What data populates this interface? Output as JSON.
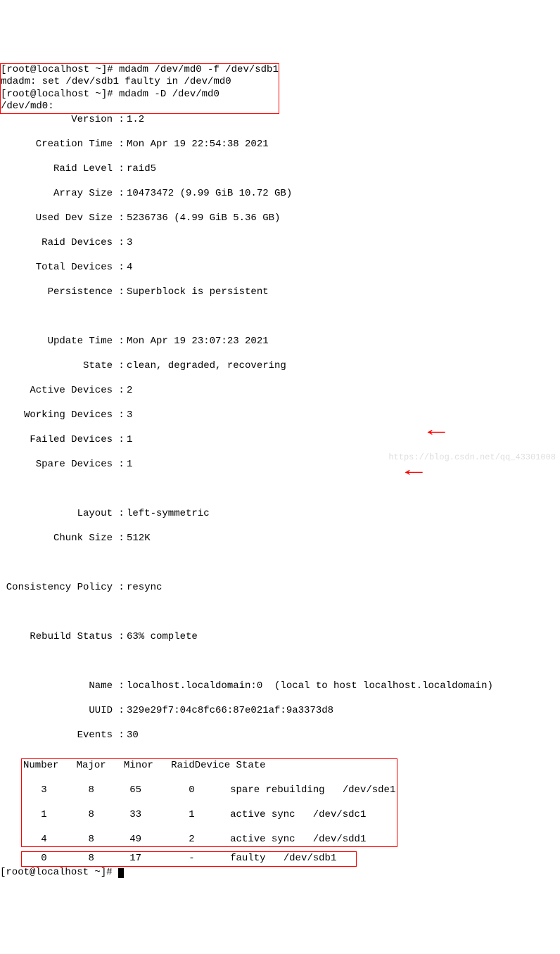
{
  "top_box": {
    "cmd1": "[root@localhost ~]# mdadm /dev/md0 -f /dev/sdb1",
    "out1": "mdadm: set /dev/sdb1 faulty in /dev/md0",
    "cmd2": "[root@localhost ~]# mdadm -D /dev/md0",
    "device": "/dev/md0:"
  },
  "detail": {
    "Version": "1.2",
    "Creation Time": "Mon Apr 19 22:54:38 2021",
    "Raid Level": "raid5",
    "Array Size": "10473472 (9.99 GiB 10.72 GB)",
    "Used Dev Size": "5236736 (4.99 GiB 5.36 GB)",
    "Raid Devices": "3",
    "Total Devices": "4",
    "Persistence": "Superblock is persistent",
    "Update Time": "Mon Apr 19 23:07:23 2021",
    "State": "clean, degraded, recovering",
    "Active Devices": "2",
    "Working Devices": "3",
    "Failed Devices": "1",
    "Spare Devices": "1",
    "Layout": "left-symmetric",
    "Chunk Size": "512K",
    "Consistency Policy": "resync",
    "Rebuild Status": "63% complete",
    "Name": "localhost.localdomain:0  (local to host localhost.localdomain)",
    "UUID": "329e29f7:04c8fc66:87e021af:9a3373d8",
    "Events": "30"
  },
  "table": {
    "headers": [
      "Number",
      "Major",
      "Minor",
      "RaidDevice",
      "State"
    ],
    "rows": [
      {
        "number": "3",
        "major": "8",
        "minor": "65",
        "rd": "0",
        "state": "spare rebuilding   /dev/sde1"
      },
      {
        "number": "1",
        "major": "8",
        "minor": "33",
        "rd": "1",
        "state": "active sync   /dev/sdc1"
      },
      {
        "number": "4",
        "major": "8",
        "minor": "49",
        "rd": "2",
        "state": "active sync   /dev/sdd1"
      }
    ],
    "faulty": {
      "number": "0",
      "major": "8",
      "minor": "17",
      "rd": "-",
      "state": "faulty   /dev/sdb1"
    }
  },
  "prompt": "[root@localhost ~]# ",
  "watermark": "https://blog.csdn.net/qq_43301008"
}
